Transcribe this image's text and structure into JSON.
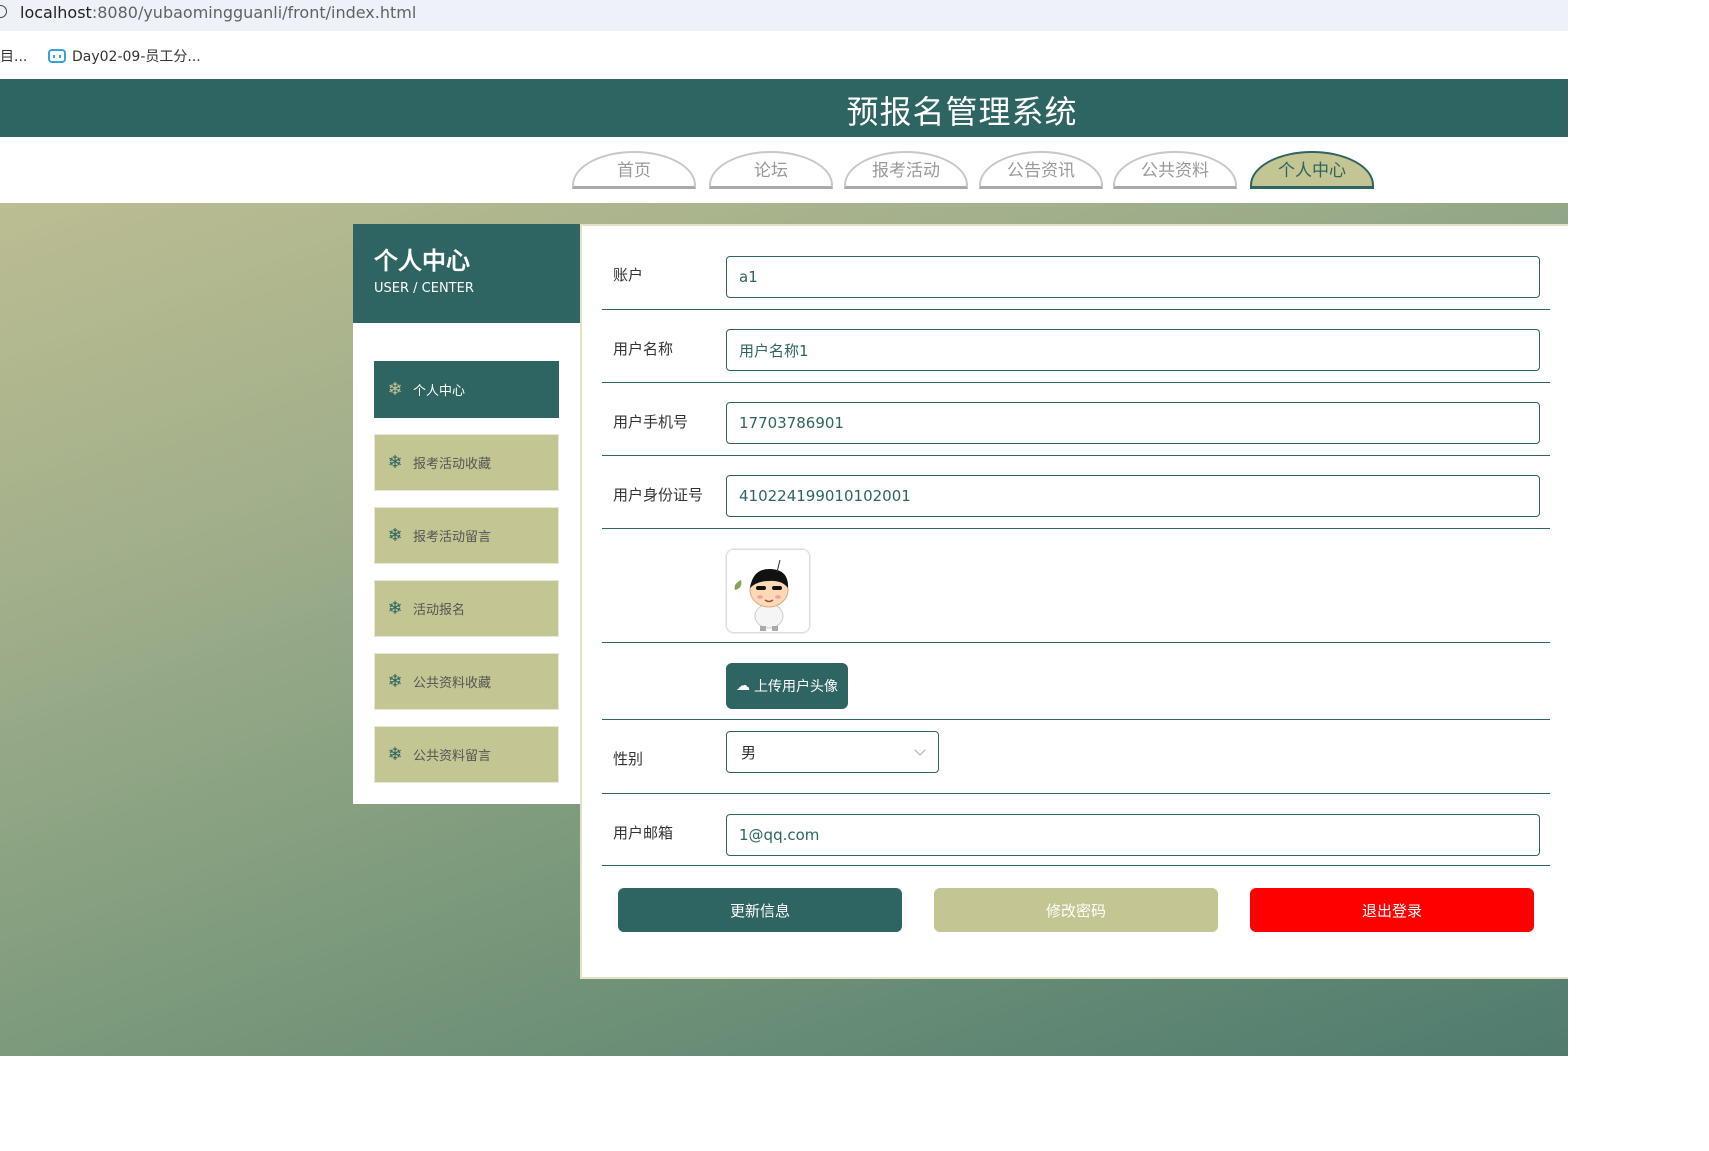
{
  "browser": {
    "url_host": "localhost",
    "url_path": ":8080/yubaomingguanli/front/index.html",
    "bookmarks": [
      {
        "label": "目..."
      },
      {
        "label": "Day02-09-员工分..."
      }
    ]
  },
  "site": {
    "title": "预报名管理系统"
  },
  "nav": {
    "tabs": [
      {
        "label": "首页"
      },
      {
        "label": "论坛"
      },
      {
        "label": "报考活动"
      },
      {
        "label": "公告资讯"
      },
      {
        "label": "公共资料"
      },
      {
        "label": "个人中心"
      }
    ]
  },
  "sidebar": {
    "title": "个人中心",
    "subtitle": "USER / CENTER",
    "icon": "snowflake-icon",
    "items": [
      {
        "label": "个人中心"
      },
      {
        "label": "报考活动收藏"
      },
      {
        "label": "报考活动留言"
      },
      {
        "label": "活动报名"
      },
      {
        "label": "公共资料收藏"
      },
      {
        "label": "公共资料留言"
      }
    ]
  },
  "form": {
    "account": {
      "label": "账户",
      "value": "a1"
    },
    "username": {
      "label": "用户名称",
      "value": "用户名称1"
    },
    "phone": {
      "label": "用户手机号",
      "value": "17703786901"
    },
    "idcard": {
      "label": "用户身份证号",
      "value": "410224199010102001"
    },
    "upload_label": "上传用户头像",
    "gender": {
      "label": "性别",
      "value": "男"
    },
    "email": {
      "label": "用户邮箱",
      "value": "1@qq.com"
    }
  },
  "actions": {
    "update": "更新信息",
    "change_password": "修改密码",
    "logout": "退出登录"
  },
  "colors": {
    "primary": "#2e6461",
    "accent": "#c3c592",
    "danger": "#ff0000"
  }
}
